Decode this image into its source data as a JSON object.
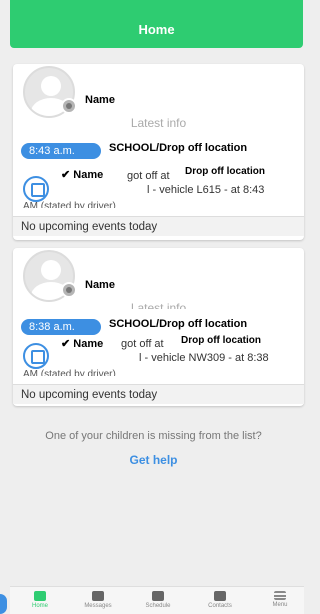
{
  "header": {
    "title": "Home"
  },
  "cards": [
    {
      "name": "Name",
      "latest_info": "Latest info",
      "time": "8:43 a.m.",
      "location_title": "SCHOOL/Drop off location",
      "check_name": "✔ Name",
      "got_off_at": "got off at",
      "drop_location": "Drop off location",
      "vehicle": "l - vehicle L615 - at 8:43",
      "stated": "AM (stated by driver)",
      "events": "No upcoming events today"
    },
    {
      "name": "Name",
      "latest_info": "Latest info",
      "time": "8:38 a.m.",
      "location_title": "SCHOOL/Drop off location",
      "check_name": "✔ Name",
      "got_off_at": "got off at",
      "drop_location": "Drop off location",
      "vehicle": "l - vehicle NW309 - at 8:38",
      "stated": "AM (stated by driver)",
      "events": "No upcoming events today"
    }
  ],
  "missing_text": "One of your children is missing from the list?",
  "get_help": "Get help",
  "nav": [
    {
      "label": "Home",
      "icon": "home-icon"
    },
    {
      "label": "Messages",
      "icon": "messages-icon"
    },
    {
      "label": "Schedule",
      "icon": "schedule-icon"
    },
    {
      "label": "Contacts",
      "icon": "contacts-icon"
    },
    {
      "label": "Menu",
      "icon": "menu-icon"
    }
  ],
  "colors": {
    "accent_green": "#2ecc71",
    "accent_blue": "#3d8fe2"
  }
}
